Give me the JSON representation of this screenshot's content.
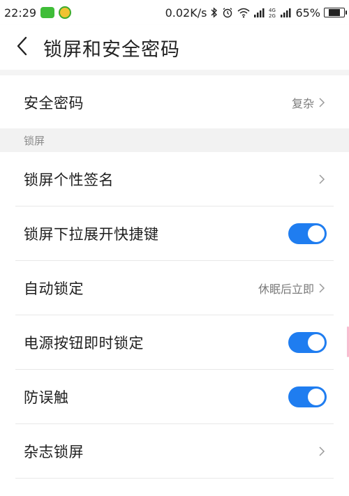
{
  "status_bar": {
    "time": "22:29",
    "net_speed": "0.02K/s",
    "battery_percent": "65%",
    "battery_level": 0.65,
    "icons": [
      "wechat-icon",
      "app-icon",
      "bluetooth-icon",
      "alarm-icon",
      "wifi-icon",
      "signal-icon",
      "signal-4g-icon",
      "signal-icon",
      "battery-icon"
    ]
  },
  "nav": {
    "title": "锁屏和安全密码",
    "back_icon": "back-arrow-icon"
  },
  "security_password": {
    "label": "安全密码",
    "value": "复杂"
  },
  "section_lockscreen": {
    "header": "锁屏",
    "items": [
      {
        "label": "锁屏个性签名",
        "type": "link",
        "value": ""
      },
      {
        "label": "锁屏下拉展开快捷键",
        "type": "toggle",
        "checked": true
      },
      {
        "label": "自动锁定",
        "type": "link",
        "value": "休眠后立即"
      },
      {
        "label": "电源按钮即时锁定",
        "type": "toggle",
        "checked": true
      },
      {
        "label": "防误触",
        "type": "toggle",
        "checked": true
      },
      {
        "label": "杂志锁屏",
        "type": "link",
        "value": ""
      }
    ]
  },
  "colors": {
    "accent": "#1f7df0",
    "section_bg": "#f2f2f2",
    "secondary_text": "#7a7a7a"
  }
}
